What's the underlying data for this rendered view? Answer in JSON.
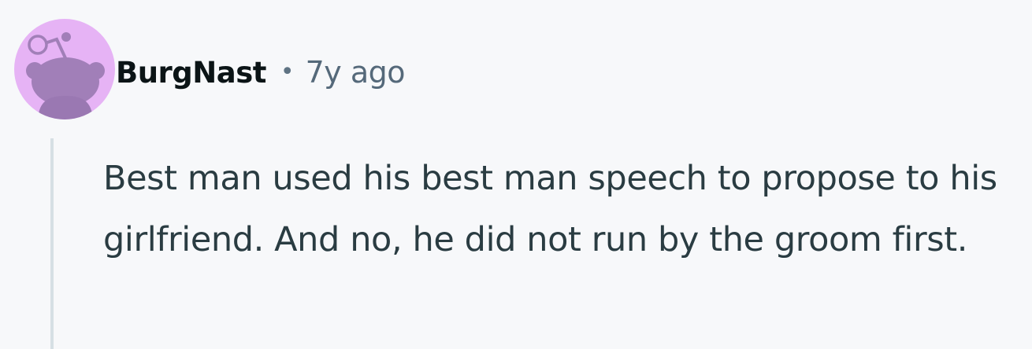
{
  "comment": {
    "author": "BurgNast",
    "separator": "•",
    "timestamp": "7y ago",
    "body": "Best man used his best man speech to propose to his girlfriend. And no, he did not run by the groom first."
  },
  "avatar": {
    "icon": "snoo-avatar-icon",
    "background_color": "#e6b3f5",
    "figure_color": "#a17fb8"
  },
  "colors": {
    "background": "#f7f8fa",
    "author": "#0b1416",
    "meta": "#55697a",
    "body_text": "#2a3c42",
    "thread_line": "#d6dfe4"
  }
}
